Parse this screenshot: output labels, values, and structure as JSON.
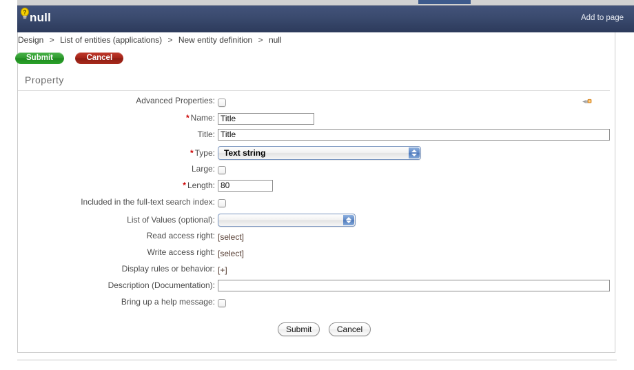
{
  "browser": {
    "tab_strip_present": true
  },
  "header": {
    "icon": "lightbulb-help-icon",
    "title": "null",
    "add_to_page_label": "Add to page"
  },
  "breadcrumb": {
    "items": [
      "Design",
      "List of entities (applications)",
      "New entity definition",
      "null"
    ],
    "separator": ">"
  },
  "top_actions": {
    "submit_label": "Submit",
    "cancel_label": "Cancel"
  },
  "section": {
    "title": "Property",
    "tool_icon": "wrench-tools-icon"
  },
  "form": {
    "fields": [
      {
        "label": "Advanced Properties:",
        "required": false,
        "control": "checkbox",
        "checked": false,
        "name": "advanced-properties"
      },
      {
        "label": "Name:",
        "required": true,
        "control": "text",
        "value": "Title",
        "placeholder": "",
        "name": "name"
      },
      {
        "label": "Title:",
        "required": false,
        "control": "text-wide",
        "value": "Title",
        "placeholder": "",
        "name": "title"
      },
      {
        "label": "Type:",
        "required": true,
        "control": "select",
        "value": "Text string",
        "name": "type"
      },
      {
        "label": "Large:",
        "required": false,
        "control": "checkbox",
        "checked": false,
        "name": "large"
      },
      {
        "label": "Length:",
        "required": true,
        "control": "text-short",
        "value": "80",
        "placeholder": "",
        "name": "length"
      },
      {
        "label": "Included in the full-text search index:",
        "required": false,
        "control": "checkbox",
        "checked": false,
        "name": "full-text-search-index"
      },
      {
        "label": "List of Values (optional):",
        "required": false,
        "control": "select-empty",
        "value": "",
        "name": "list-of-values"
      },
      {
        "label": "Read access right:",
        "required": false,
        "control": "link",
        "value": "[select]",
        "name": "read-access-right"
      },
      {
        "label": "Write access right:",
        "required": false,
        "control": "link",
        "value": "[select]",
        "name": "write-access-right"
      },
      {
        "label": "Display rules or behavior:",
        "required": false,
        "control": "link",
        "value": "[+]",
        "name": "display-rules-or-behavior"
      },
      {
        "label": "Description (Documentation):",
        "required": false,
        "control": "text-wide",
        "value": "",
        "placeholder": "",
        "name": "description-documentation"
      },
      {
        "label": "Bring up a help message:",
        "required": false,
        "control": "checkbox",
        "checked": false,
        "name": "bring-up-help-message"
      }
    ]
  },
  "bottom_actions": {
    "submit_label": "Submit",
    "cancel_label": "Cancel"
  },
  "colors": {
    "header_top": "#43537a",
    "header_bottom": "#2c3a5b",
    "submit_green": "#2f9b2f",
    "cancel_red": "#a52419",
    "required_star": "#cc0000",
    "select_border_blue": "#7b96bf",
    "tab_active_blue": "#3d5a8c"
  }
}
